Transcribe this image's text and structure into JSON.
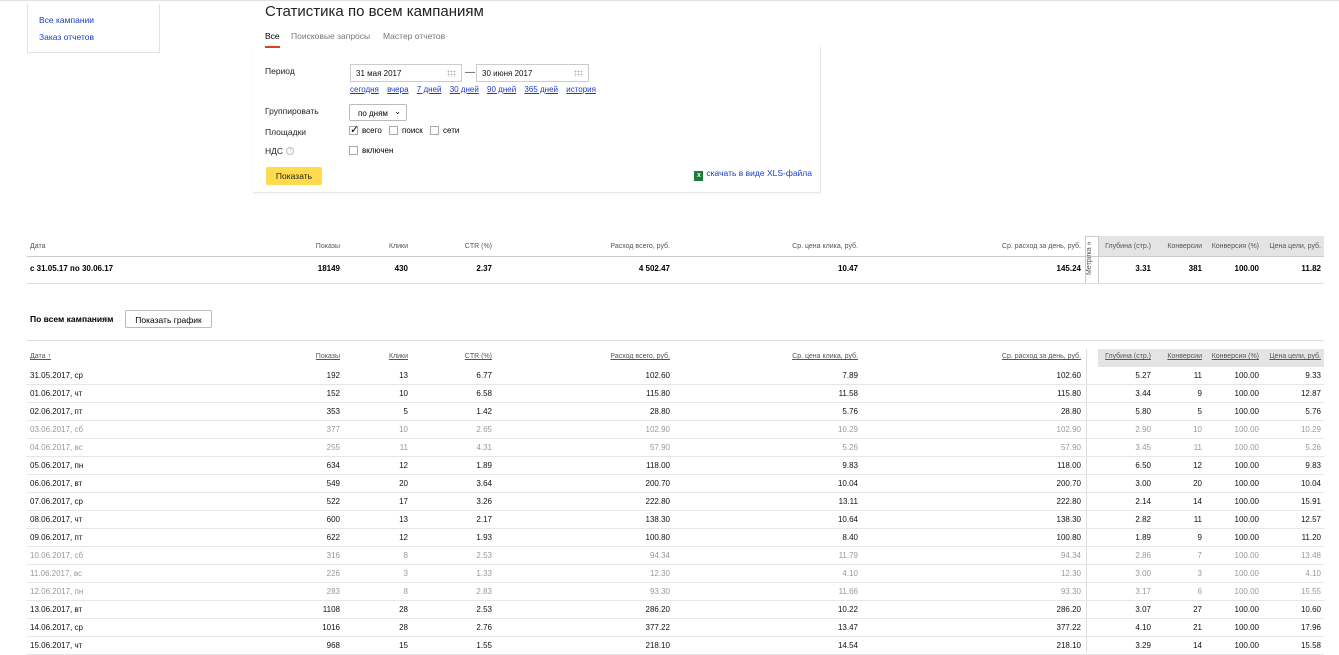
{
  "sidebar": {
    "items": [
      {
        "label": "Все кампании"
      },
      {
        "label": "Заказ отчетов"
      }
    ]
  },
  "page": {
    "title": "Статистика по всем кампаниям"
  },
  "tabs": [
    {
      "label": "Все",
      "active": true
    },
    {
      "label": "Поисковые запросы"
    },
    {
      "label": "Мастер отчетов"
    }
  ],
  "filters": {
    "period_label": "Период",
    "date_from": "31 мая 2017",
    "date_to": "30 июня 2017",
    "quick_ranges": [
      "сегодня",
      "вчера",
      "7 дней",
      "30 дней",
      "90 дней",
      "365 дней",
      "история"
    ],
    "group_label": "Группировать",
    "group_value": "по дням",
    "sites_label": "Площадки",
    "sites": [
      {
        "label": "всего",
        "checked": true
      },
      {
        "label": "поиск",
        "checked": false
      },
      {
        "label": "сети",
        "checked": false
      }
    ],
    "vat_label": "НДС",
    "vat_help": "?",
    "vat_option": "включен",
    "show_button": "Показать",
    "xls_link": "скачать в виде XLS-файла",
    "xls_icon": "excel-icon"
  },
  "table": {
    "headers": [
      "Дата",
      "Показы",
      "Клики",
      "CTR (%)",
      "Расход всего, руб.",
      "Ср. цена клика, руб.",
      "Ср. расход за день, руб.",
      "Глубина (стр.)",
      "Конверсии",
      "Конверсия (%)",
      "Цена цели, руб."
    ],
    "date_sorted_header": "Дата ↑",
    "metrika_label": "Метрика »",
    "summary": [
      "с 31.05.17 по 30.06.17",
      "18149",
      "430",
      "2.37",
      "4 502.47",
      "10.47",
      "145.24",
      "3.31",
      "381",
      "100.00",
      "11.82"
    ],
    "section_title": "По всем кампаниям",
    "graph_button": "Показать график",
    "rows": [
      [
        "31.05.2017, ср",
        "192",
        "13",
        "6.77",
        "102.60",
        "7.89",
        "102.60",
        "5.27",
        "11",
        "100.00",
        "9.33"
      ],
      [
        "01.06.2017, чт",
        "152",
        "10",
        "6.58",
        "115.80",
        "11.58",
        "115.80",
        "3.44",
        "9",
        "100.00",
        "12.87"
      ],
      [
        "02.06.2017, пт",
        "353",
        "5",
        "1.42",
        "28.80",
        "5.76",
        "28.80",
        "5.80",
        "5",
        "100.00",
        "5.76"
      ],
      [
        "03.06.2017, сб",
        "377",
        "10",
        "2.65",
        "102.90",
        "10.29",
        "102.90",
        "2.90",
        "10",
        "100.00",
        "10.29"
      ],
      [
        "04.06.2017, вс",
        "255",
        "11",
        "4.31",
        "57.90",
        "5.26",
        "57.90",
        "3.45",
        "11",
        "100.00",
        "5.26"
      ],
      [
        "05.06.2017, пн",
        "634",
        "12",
        "1.89",
        "118.00",
        "9.83",
        "118.00",
        "6.50",
        "12",
        "100.00",
        "9.83"
      ],
      [
        "06.06.2017, вт",
        "549",
        "20",
        "3.64",
        "200.70",
        "10.04",
        "200.70",
        "3.00",
        "20",
        "100.00",
        "10.04"
      ],
      [
        "07.06.2017, ср",
        "522",
        "17",
        "3.26",
        "222.80",
        "13.11",
        "222.80",
        "2.14",
        "14",
        "100.00",
        "15.91"
      ],
      [
        "08.06.2017, чт",
        "600",
        "13",
        "2.17",
        "138.30",
        "10.64",
        "138.30",
        "2.82",
        "11",
        "100.00",
        "12.57"
      ],
      [
        "09.06.2017, пт",
        "622",
        "12",
        "1.93",
        "100.80",
        "8.40",
        "100.80",
        "1.89",
        "9",
        "100.00",
        "11.20"
      ],
      [
        "10.06.2017, сб",
        "316",
        "8",
        "2.53",
        "94.34",
        "11.79",
        "94.34",
        "2.86",
        "7",
        "100.00",
        "13.48"
      ],
      [
        "11.06.2017, вс",
        "226",
        "3",
        "1.33",
        "12.30",
        "4.10",
        "12.30",
        "3.00",
        "3",
        "100.00",
        "4.10"
      ],
      [
        "12.06.2017, пн",
        "283",
        "8",
        "2.83",
        "93.30",
        "11.66",
        "93.30",
        "3.17",
        "6",
        "100.00",
        "15.55"
      ],
      [
        "13.06.2017, вт",
        "1108",
        "28",
        "2.53",
        "286.20",
        "10.22",
        "286.20",
        "3.07",
        "27",
        "100.00",
        "10.60"
      ],
      [
        "14.06.2017, ср",
        "1016",
        "28",
        "2.76",
        "377.22",
        "13.47",
        "377.22",
        "4.10",
        "21",
        "100.00",
        "17.96"
      ],
      [
        "15.06.2017, чт",
        "968",
        "15",
        "1.55",
        "218.10",
        "14.54",
        "218.10",
        "3.29",
        "14",
        "100.00",
        "15.58"
      ]
    ],
    "weekend_rows": [
      3,
      4,
      10,
      11,
      12
    ]
  }
}
